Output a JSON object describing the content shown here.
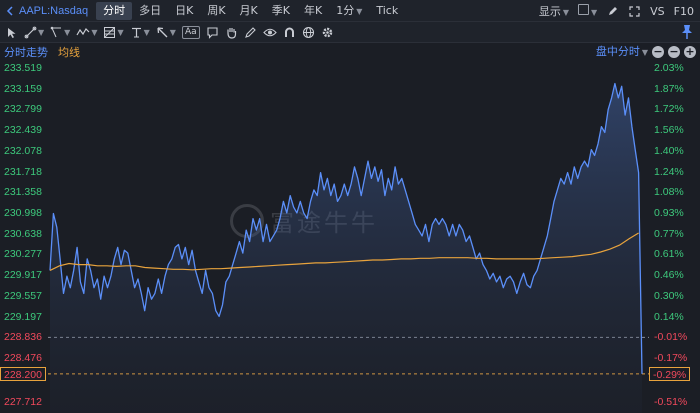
{
  "header": {
    "symbol": "AAPL:Nasdaq",
    "periods": [
      "分时",
      "多日",
      "日K",
      "周K",
      "月K",
      "季K",
      "年K",
      "1分",
      "Tick"
    ],
    "active_period": "分时",
    "display_label": "显示",
    "vs_label": "VS",
    "f10_label": "F10"
  },
  "drawing_tools": [
    "crosshair",
    "line",
    "polyline",
    "wave",
    "grid-chart",
    "price-line",
    "arrow",
    "text",
    "comment",
    "hand",
    "pencil",
    "eye",
    "magnet",
    "globe",
    "settings"
  ],
  "chart_header": {
    "tab_timeshare": "分时走势",
    "tab_average": "均线",
    "session": "盘中分时"
  },
  "watermark": "富途牛牛",
  "colors": {
    "price_line": "#5b8ff9",
    "average_line": "#e8a33d",
    "up": "#3dc97c",
    "down": "#f2495c",
    "background": "#1b1e25"
  },
  "axis": {
    "left": [
      "233.519",
      "233.159",
      "232.799",
      "232.439",
      "232.078",
      "231.718",
      "231.358",
      "230.998",
      "230.638",
      "230.277",
      "229.917",
      "229.557",
      "229.197",
      "228.836",
      "228.476",
      "228.200",
      "227.712"
    ],
    "right": [
      "2.03%",
      "1.87%",
      "1.72%",
      "1.56%",
      "1.40%",
      "1.24%",
      "1.08%",
      "0.93%",
      "0.77%",
      "0.61%",
      "0.46%",
      "0.30%",
      "0.14%",
      "-0.01%",
      "-0.17%",
      "-0.29%",
      "-0.51%"
    ]
  },
  "chart_data": {
    "type": "line",
    "title": "",
    "xlabel": "",
    "ylabel": "",
    "ylim": [
      227.712,
      233.519
    ],
    "prev_close": 228.836,
    "current_price": 228.2,
    "current_pct": "-0.29%",
    "series": [
      {
        "values": [
          230.0,
          230.99,
          230.75,
          230.2,
          229.6,
          229.9,
          229.7,
          230.0,
          230.4,
          229.8,
          229.6,
          230.2,
          230.0,
          229.7,
          229.85,
          229.5,
          229.9,
          229.7,
          229.9,
          230.2,
          230.4,
          230.1,
          230.35,
          230.3,
          230.0,
          229.7,
          229.85,
          229.6,
          229.3,
          229.7,
          229.5,
          229.6,
          229.85,
          229.6,
          229.9,
          230.1,
          230.2,
          230.4,
          230.45,
          230.2,
          230.4,
          230.1,
          230.35,
          230.0,
          229.8,
          229.6,
          230.0,
          229.7,
          229.6,
          229.3,
          229.2,
          229.4,
          229.8,
          229.9,
          230.1,
          230.3,
          230.5,
          230.3,
          230.7,
          230.5,
          230.9,
          230.7,
          230.9,
          230.5,
          230.8,
          230.5,
          230.6,
          230.7,
          230.9,
          231.2,
          231.0,
          231.3,
          231.1,
          231.0,
          231.2,
          231.0,
          230.9,
          231.2,
          231.4,
          231.3,
          231.7,
          231.4,
          231.6,
          231.3,
          231.5,
          231.2,
          231.3,
          231.5,
          231.3,
          231.5,
          231.8,
          231.6,
          231.3,
          231.6,
          231.9,
          231.6,
          231.8,
          231.55,
          231.75,
          231.3,
          231.6,
          231.4,
          231.8,
          231.5,
          231.6,
          231.4,
          231.2,
          231.0,
          230.8,
          230.7,
          230.6,
          230.8,
          230.5,
          230.8,
          230.9,
          230.8,
          230.9,
          230.8,
          230.6,
          230.8,
          230.6,
          230.8,
          230.7,
          230.5,
          230.6,
          230.4,
          230.2,
          230.3,
          230.1,
          230.0,
          229.85,
          229.95,
          229.8,
          229.9,
          229.7,
          229.85,
          229.9,
          229.8,
          229.6,
          229.8,
          229.95,
          229.75,
          229.7,
          229.9,
          230.0,
          230.2,
          230.4,
          230.6,
          230.9,
          231.2,
          231.4,
          231.6,
          231.5,
          231.7,
          231.5,
          231.8,
          231.6,
          231.8,
          231.9,
          231.8,
          232.1,
          232.0,
          232.2,
          232.5,
          232.4,
          232.8,
          233.0,
          233.25,
          233.0,
          233.2,
          232.7,
          233.0,
          232.5,
          232.1,
          231.7,
          228.2
        ]
      },
      {
        "values": [
          230.0,
          230.08,
          230.12,
          230.1,
          230.1,
          230.08,
          230.08,
          230.07,
          230.08,
          230.08,
          230.05,
          230.04,
          230.03,
          230.02,
          230.02,
          230.01,
          230.02,
          230.03,
          230.03,
          230.04,
          230.05,
          230.06,
          230.07,
          230.08,
          230.09,
          230.1,
          230.11,
          230.12,
          230.13,
          230.13,
          230.14,
          230.15,
          230.16,
          230.17,
          230.18,
          230.18,
          230.19,
          230.2,
          230.2,
          230.21,
          230.21,
          230.22,
          230.22,
          230.22,
          230.22,
          230.21,
          230.21,
          230.2,
          230.2,
          230.2,
          230.2,
          230.2,
          230.21,
          230.22,
          230.23,
          230.24,
          230.26,
          230.28,
          230.32,
          230.37,
          230.44,
          230.55,
          230.65
        ]
      }
    ]
  }
}
